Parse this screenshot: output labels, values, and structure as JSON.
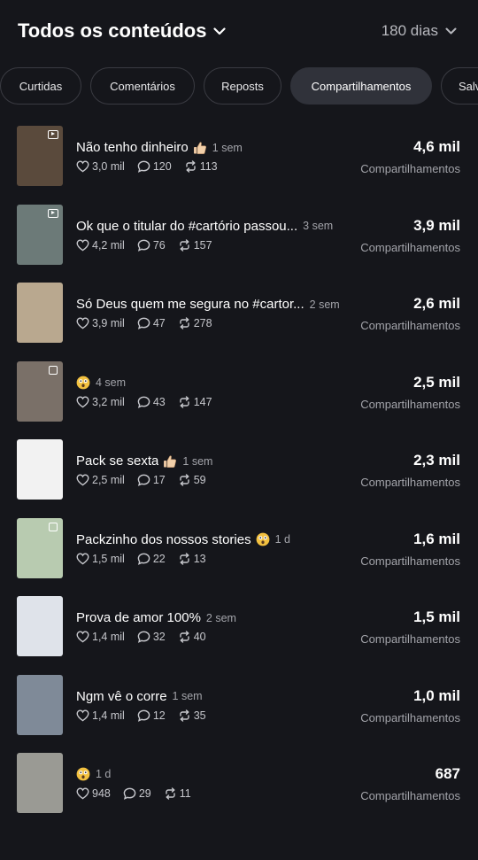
{
  "header": {
    "title": "Todos os conteúdos",
    "period": "180 dias"
  },
  "tabs": [
    "Curtidas",
    "Comentários",
    "Reposts",
    "Compartilhamentos",
    "Salv"
  ],
  "active_tab": "Compartilhamentos",
  "metric_label": "Compartilhamentos",
  "icons": {
    "like": "heart-outline-icon",
    "comment": "speech-bubble-icon",
    "repost": "repost-arrows-icon",
    "dropdown": "chevron-down-icon",
    "thumbs_up": "thumbs-up-emoji",
    "shocked": "shocked-face-emoji"
  },
  "items": [
    {
      "caption": "Não tenho dinheiro",
      "emoji": "thumbs-up",
      "age": "1 sem",
      "likes": "3,0 mil",
      "comments": "120",
      "reposts": "113",
      "value": "4,6 mil",
      "thumb_color": "#5a4a3c",
      "thumb_badge": "play"
    },
    {
      "caption": "Ok que o titular do #cartório passou...",
      "emoji": "",
      "age": "3 sem",
      "likes": "4,2 mil",
      "comments": "76",
      "reposts": "157",
      "value": "3,9 mil",
      "thumb_color": "#6c7a78",
      "thumb_badge": "play"
    },
    {
      "caption": "Só Deus quem me segura no #cartor...",
      "emoji": "",
      "age": "2 sem",
      "likes": "3,9 mil",
      "comments": "47",
      "reposts": "278",
      "value": "2,6 mil",
      "thumb_color": "#b9a88f",
      "thumb_badge": ""
    },
    {
      "caption": "",
      "emoji": "shocked",
      "age": "4 sem",
      "likes": "3,2 mil",
      "comments": "43",
      "reposts": "147",
      "value": "2,5 mil",
      "thumb_color": "#7a7068",
      "thumb_badge": "multi"
    },
    {
      "caption": "Pack se sexta",
      "emoji": "thumbs-up",
      "age": "1 sem",
      "likes": "2,5 mil",
      "comments": "17",
      "reposts": "59",
      "value": "2,3 mil",
      "thumb_color": "#f2f2f2",
      "thumb_badge": ""
    },
    {
      "caption": "Packzinho dos nossos stories",
      "emoji": "shocked",
      "age": "1 d",
      "likes": "1,5 mil",
      "comments": "22",
      "reposts": "13",
      "value": "1,6 mil",
      "thumb_color": "#b8cbb0",
      "thumb_badge": "multi"
    },
    {
      "caption": "Prova de amor 100%",
      "emoji": "",
      "age": "2 sem",
      "likes": "1,4 mil",
      "comments": "32",
      "reposts": "40",
      "value": "1,5 mil",
      "thumb_color": "#dfe3ea",
      "thumb_badge": ""
    },
    {
      "caption": "Ngm vê o corre",
      "emoji": "",
      "age": "1 sem",
      "likes": "1,4 mil",
      "comments": "12",
      "reposts": "35",
      "value": "1,0 mil",
      "thumb_color": "#7f8a98",
      "thumb_badge": ""
    },
    {
      "caption": "",
      "emoji": "shocked",
      "age": "1 d",
      "likes": "948",
      "comments": "29",
      "reposts": "11",
      "value": "687",
      "thumb_color": "#9a9a94",
      "thumb_badge": ""
    }
  ]
}
